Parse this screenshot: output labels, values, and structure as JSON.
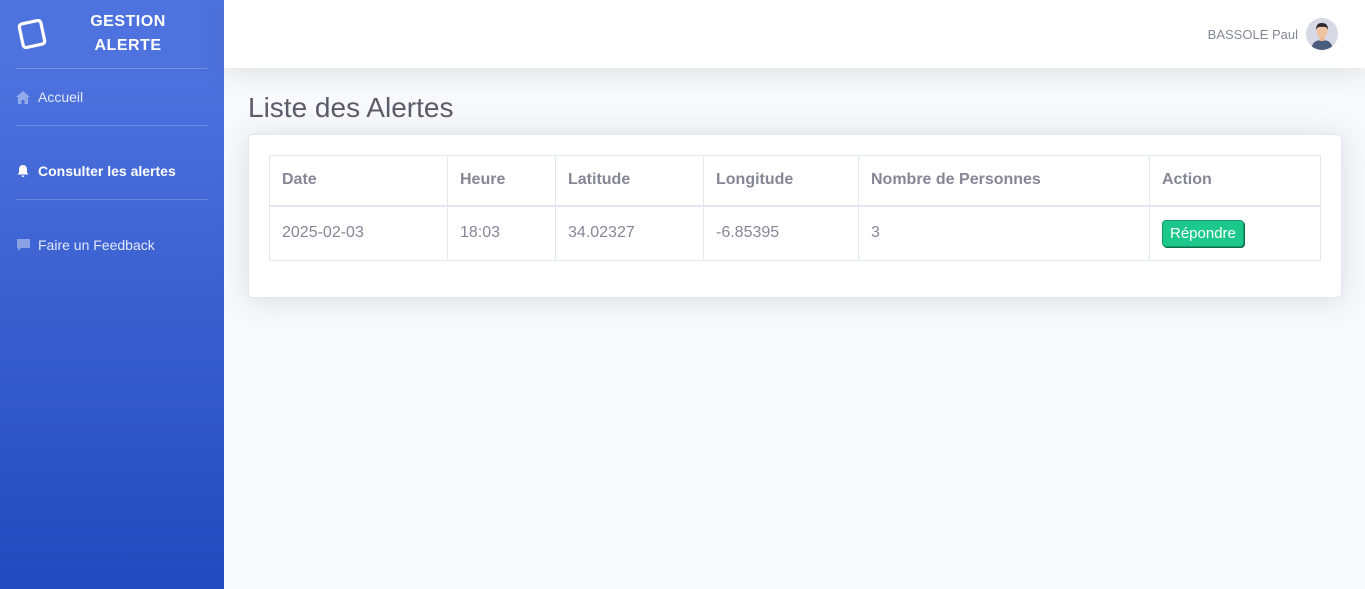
{
  "sidebar": {
    "brand": {
      "line1": "GESTION",
      "line2": "ALERTE",
      "icon": "clipboard-icon"
    },
    "items": [
      {
        "label": "Accueil",
        "icon": "home-icon",
        "active": false
      },
      {
        "label": "Consulter les alertes",
        "icon": "bell-icon",
        "active": true
      },
      {
        "label": "Faire un Feedback",
        "icon": "comment-icon",
        "active": false
      }
    ]
  },
  "topbar": {
    "user_name": "BASSOLE Paul",
    "avatar_icon": "avatar-icon"
  },
  "main": {
    "title": "Liste des Alertes",
    "table": {
      "headers": [
        "Date",
        "Heure",
        "Latitude",
        "Longitude",
        "Nombre de Personnes",
        "Action"
      ],
      "rows": [
        {
          "date": "2025-02-03",
          "heure": "18:03",
          "latitude": "34.02327",
          "longitude": "-6.85395",
          "personnes": "3",
          "action_label": "Répondre"
        }
      ]
    }
  },
  "colors": {
    "sidebar_top": "#4e73df",
    "sidebar_bottom": "#224abe",
    "success": "#1cc88a",
    "background": "#f8f9fc"
  }
}
